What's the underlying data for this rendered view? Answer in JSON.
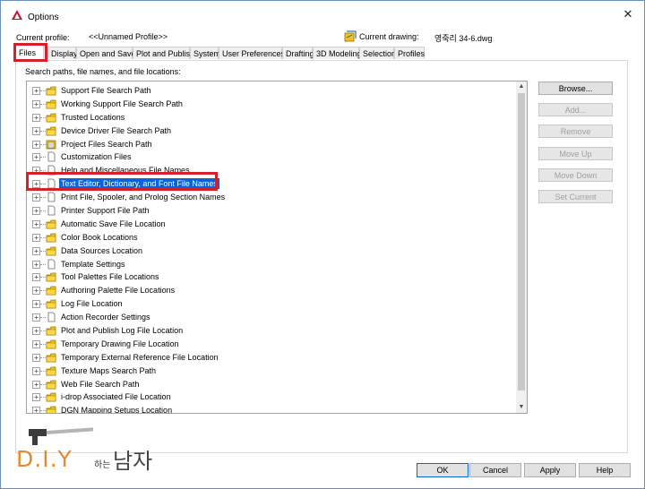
{
  "window": {
    "title": "Options",
    "close_glyph": "✕"
  },
  "profile": {
    "current_profile_label": "Current profile:",
    "current_profile_value": "<<Unnamed Profile>>",
    "current_drawing_label": "Current drawing:",
    "current_drawing_value": "영죽리 34-6.dwg"
  },
  "tabs": [
    "Files",
    "Display",
    "Open and Save",
    "Plot and Publish",
    "System",
    "User Preferences",
    "Drafting",
    "3D Modeling",
    "Selection",
    "Profiles"
  ],
  "active_tab": "Files",
  "panel_caption": "Search paths, file names, and file locations:",
  "tree": [
    {
      "label": "Support File Search Path",
      "icon": "folder-icon"
    },
    {
      "label": "Working Support File Search Path",
      "icon": "folder-icon"
    },
    {
      "label": "Trusted Locations",
      "icon": "folder-icon"
    },
    {
      "label": "Device Driver File Search Path",
      "icon": "folder-icon"
    },
    {
      "label": "Project Files Search Path",
      "icon": "document-list-icon"
    },
    {
      "label": "Customization Files",
      "icon": "file-icon"
    },
    {
      "label": "Help and Miscellaneous File Names",
      "icon": "file-icon"
    },
    {
      "label": "Text Editor, Dictionary, and Font File Names",
      "icon": "file-icon",
      "selected": true
    },
    {
      "label": "Print File, Spooler, and Prolog Section Names",
      "icon": "file-icon"
    },
    {
      "label": "Printer Support File Path",
      "icon": "file-icon"
    },
    {
      "label": "Automatic Save File Location",
      "icon": "folder-icon"
    },
    {
      "label": "Color Book Locations",
      "icon": "folder-icon"
    },
    {
      "label": "Data Sources Location",
      "icon": "folder-icon"
    },
    {
      "label": "Template Settings",
      "icon": "file-icon"
    },
    {
      "label": "Tool Palettes File Locations",
      "icon": "folder-icon"
    },
    {
      "label": "Authoring Palette File Locations",
      "icon": "folder-icon"
    },
    {
      "label": "Log File Location",
      "icon": "folder-icon"
    },
    {
      "label": "Action Recorder Settings",
      "icon": "file-icon"
    },
    {
      "label": "Plot and Publish Log File Location",
      "icon": "folder-icon"
    },
    {
      "label": "Temporary Drawing File Location",
      "icon": "folder-icon"
    },
    {
      "label": "Temporary External Reference File Location",
      "icon": "folder-icon"
    },
    {
      "label": "Texture Maps Search Path",
      "icon": "folder-icon"
    },
    {
      "label": "Web File Search Path",
      "icon": "folder-icon"
    },
    {
      "label": "i-drop Associated File Location",
      "icon": "folder-icon"
    },
    {
      "label": "DGN Mapping Setups Location",
      "icon": "folder-icon"
    }
  ],
  "side_buttons": [
    {
      "label": "Browse...",
      "enabled": true
    },
    {
      "label": "Add...",
      "enabled": false
    },
    {
      "label": "Remove",
      "enabled": false
    },
    {
      "label": "Move Up",
      "enabled": false
    },
    {
      "label": "Move Down",
      "enabled": false
    },
    {
      "label": "Set Current",
      "enabled": false
    }
  ],
  "bottom_buttons": {
    "ok": "OK",
    "cancel": "Cancel",
    "apply": "Apply",
    "help": "Help"
  },
  "watermark": {
    "text": "D.I.Y",
    "small": "하는",
    "korean": "남자"
  },
  "colors": {
    "highlight_box": "#d61f2a",
    "selection": "#0a64d8",
    "folder": "#f5c518",
    "watermark": "#e38b2b"
  }
}
